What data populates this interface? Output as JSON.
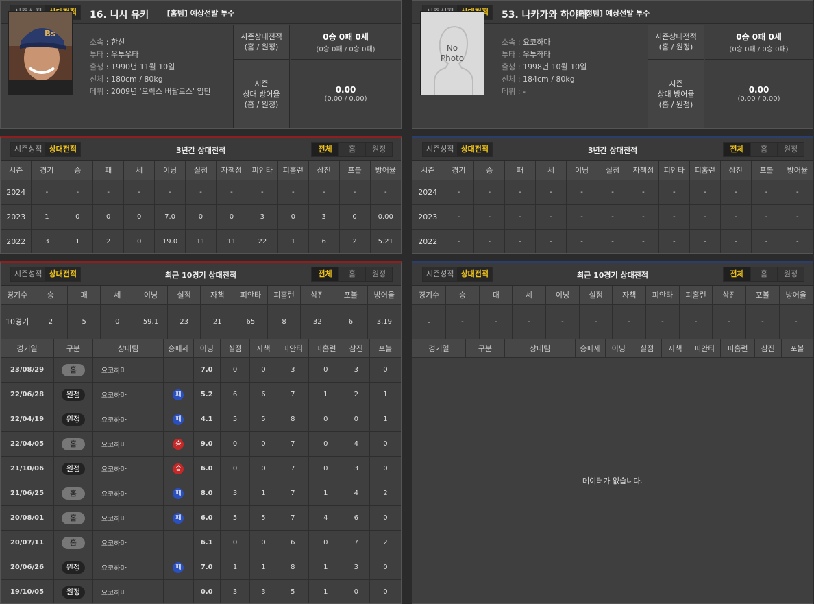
{
  "left": {
    "tab_season": "시즌성적",
    "tab_vs": "상대전적",
    "title": "[홈팀] 예상선발 투수",
    "player": {
      "name": "16. 니시 유키",
      "info": [
        [
          "소속",
          "한신"
        ],
        [
          "투타",
          "우투우타"
        ],
        [
          "출생",
          "1990년 11월 10일"
        ],
        [
          "신체",
          "180cm / 80kg"
        ],
        [
          "데뷔",
          "2009년 '오릭스 버팔로스' 입단"
        ]
      ]
    },
    "stat1_label": "시즌상대전적\n(홈 / 원정)",
    "stat1_big": "0승 0패 0세",
    "stat1_small": "(0승 0패 / 0승 0패)",
    "stat2_label": "시즌\n상대 방어율\n(홈 / 원정)",
    "stat2_big": "0.00",
    "stat2_small": "(0.00 / 0.00)",
    "three_title": "3년간 상대전적",
    "seg": [
      "전체",
      "홈",
      "원정"
    ],
    "three_headers": [
      "시즌",
      "경기",
      "승",
      "패",
      "세",
      "이닝",
      "실점",
      "자책점",
      "피안타",
      "피홈런",
      "삼진",
      "포볼",
      "방어율"
    ],
    "three_rows": [
      [
        "2024",
        "-",
        "-",
        "-",
        "-",
        "-",
        "-",
        "-",
        "-",
        "-",
        "-",
        "-",
        "-"
      ],
      [
        "2023",
        "1",
        "0",
        "0",
        "0",
        "7.0",
        "0",
        "0",
        "3",
        "0",
        "3",
        "0",
        "0.00"
      ],
      [
        "2022",
        "3",
        "1",
        "2",
        "0",
        "19.0",
        "11",
        "11",
        "22",
        "1",
        "6",
        "2",
        "5.21"
      ]
    ],
    "ten_title": "최근 10경기 상대전적",
    "ten_headers": [
      "경기수",
      "승",
      "패",
      "세",
      "이닝",
      "실점",
      "자책",
      "피안타",
      "피홈런",
      "삼진",
      "포볼",
      "방어율"
    ],
    "ten_row": [
      "10경기",
      "2",
      "5",
      "0",
      "59.1",
      "23",
      "21",
      "65",
      "8",
      "32",
      "6",
      "3.19"
    ],
    "game_headers": [
      "경기일",
      "구분",
      "상대팀",
      "승패세",
      "이닝",
      "실점",
      "자책",
      "피안타",
      "피홈런",
      "삼진",
      "포볼"
    ],
    "games": [
      [
        "23/08/29",
        "홈",
        "요코하마",
        "",
        "7.0",
        "0",
        "0",
        "3",
        "0",
        "3",
        "0"
      ],
      [
        "22/06/28",
        "원정",
        "요코하마",
        "패",
        "5.2",
        "6",
        "6",
        "7",
        "1",
        "2",
        "1"
      ],
      [
        "22/04/19",
        "원정",
        "요코하마",
        "패",
        "4.1",
        "5",
        "5",
        "8",
        "0",
        "0",
        "1"
      ],
      [
        "22/04/05",
        "홈",
        "요코하마",
        "승",
        "9.0",
        "0",
        "0",
        "7",
        "0",
        "4",
        "0"
      ],
      [
        "21/10/06",
        "원정",
        "요코하마",
        "승",
        "6.0",
        "0",
        "0",
        "7",
        "0",
        "3",
        "0"
      ],
      [
        "21/06/25",
        "홈",
        "요코하마",
        "패",
        "8.0",
        "3",
        "1",
        "7",
        "1",
        "4",
        "2"
      ],
      [
        "20/08/01",
        "홈",
        "요코하마",
        "패",
        "6.0",
        "5",
        "5",
        "7",
        "4",
        "6",
        "0"
      ],
      [
        "20/07/11",
        "홈",
        "요코하마",
        "",
        "6.1",
        "0",
        "0",
        "6",
        "0",
        "7",
        "2"
      ],
      [
        "20/06/26",
        "원정",
        "요코하마",
        "패",
        "7.0",
        "1",
        "1",
        "8",
        "1",
        "3",
        "0"
      ],
      [
        "19/10/05",
        "원정",
        "요코하마",
        "",
        "0.0",
        "3",
        "3",
        "5",
        "1",
        "0",
        "0"
      ]
    ]
  },
  "right": {
    "tab_season": "시즌성적",
    "tab_vs": "상대전적",
    "title": "[원정팀] 예상선발 투수",
    "photo_text": "No\nPhoto",
    "player": {
      "name": "53. 나카가와 하야테",
      "info": [
        [
          "소속",
          "요코하마"
        ],
        [
          "투타",
          "우투좌타"
        ],
        [
          "출생",
          "1998년 10월 10일"
        ],
        [
          "신체",
          "184cm / 80kg"
        ],
        [
          "데뷔",
          "-"
        ]
      ]
    },
    "stat1_label": "시즌상대전적\n(홈 / 원정)",
    "stat1_big": "0승 0패 0세",
    "stat1_small": "(0승 0패 / 0승 0패)",
    "stat2_label": "시즌\n상대 방어율\n(홈 / 원정)",
    "stat2_big": "0.00",
    "stat2_small": "(0.00 / 0.00)",
    "three_title": "3년간 상대전적",
    "seg": [
      "전체",
      "홈",
      "원정"
    ],
    "three_headers": [
      "시즌",
      "경기",
      "승",
      "패",
      "세",
      "이닝",
      "실점",
      "자책점",
      "피안타",
      "피홈런",
      "삼진",
      "포볼",
      "방어율"
    ],
    "three_rows": [
      [
        "2024",
        "-",
        "-",
        "-",
        "-",
        "-",
        "-",
        "-",
        "-",
        "-",
        "-",
        "-",
        "-"
      ],
      [
        "2023",
        "-",
        "-",
        "-",
        "-",
        "-",
        "-",
        "-",
        "-",
        "-",
        "-",
        "-",
        "-"
      ],
      [
        "2022",
        "-",
        "-",
        "-",
        "-",
        "-",
        "-",
        "-",
        "-",
        "-",
        "-",
        "-",
        "-"
      ]
    ],
    "ten_title": "최근 10경기 상대전적",
    "ten_headers": [
      "경기수",
      "승",
      "패",
      "세",
      "이닝",
      "실점",
      "자책",
      "피안타",
      "피홈런",
      "삼진",
      "포볼",
      "방어율"
    ],
    "ten_row": [
      "-",
      "-",
      "-",
      "-",
      "-",
      "-",
      "-",
      "-",
      "-",
      "-",
      "-",
      "-"
    ],
    "game_headers": [
      "경기일",
      "구분",
      "상대팀",
      "승패세",
      "이닝",
      "실점",
      "자책",
      "피안타",
      "피홈런",
      "삼진",
      "포볼"
    ],
    "empty": "데이터가 없습니다."
  }
}
